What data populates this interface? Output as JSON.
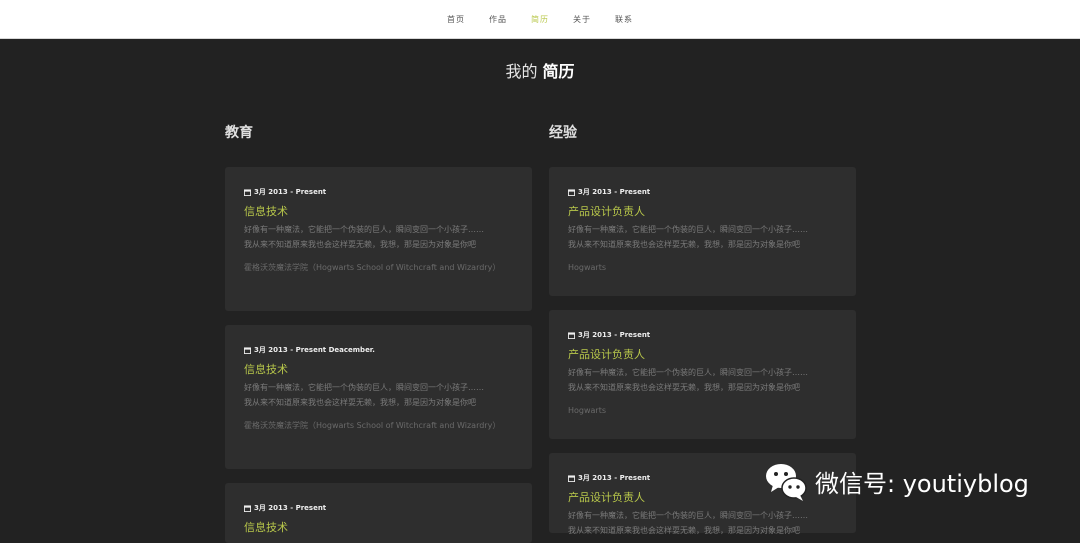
{
  "nav": {
    "items": [
      {
        "label": "首页",
        "active": false
      },
      {
        "label": "作品",
        "active": false
      },
      {
        "label": "简历",
        "active": true
      },
      {
        "label": "关于",
        "active": false
      },
      {
        "label": "联系",
        "active": false
      }
    ]
  },
  "page_title": {
    "prefix": "我的",
    "main": "简历"
  },
  "education": {
    "heading": "教育",
    "cards": [
      {
        "date": "3月 2013 - Present",
        "role": "信息技术",
        "desc1": "好像有一种魔法，它能把一个伪装的巨人，瞬间变回一个小孩子……",
        "desc2": "我从来不知道原来我也会这样耍无赖，我想，那是因为对象是你吧",
        "org": "霍格沃茨魔法学院（Hogwarts School of Witchcraft and Wizardry）"
      },
      {
        "date": "3月 2013 - Present Deacember.",
        "role": "信息技术",
        "desc1": "好像有一种魔法，它能把一个伪装的巨人，瞬间变回一个小孩子……",
        "desc2": "我从来不知道原来我也会这样耍无赖，我想，那是因为对象是你吧",
        "org": "霍格沃茨魔法学院（Hogwarts School of Witchcraft and Wizardry）"
      },
      {
        "date": "3月 2013 - Present",
        "role": "信息技术"
      }
    ]
  },
  "experience": {
    "heading": "经验",
    "cards": [
      {
        "date": "3月 2013 - Present",
        "role": "产品设计负责人",
        "desc1": "好像有一种魔法，它能把一个伪装的巨人，瞬间变回一个小孩子……",
        "desc2": "我从来不知道原来我也会这样耍无赖，我想，那是因为对象是你吧",
        "org": "Hogwarts"
      },
      {
        "date": "3月 2013 - Present",
        "role": "产品设计负责人",
        "desc1": "好像有一种魔法，它能把一个伪装的巨人，瞬间变回一个小孩子……",
        "desc2": "我从来不知道原来我也会这样耍无赖，我想，那是因为对象是你吧",
        "org": "Hogwarts"
      },
      {
        "date": "3月 2013 - Present",
        "role": "产品设计负责人",
        "desc1": "好像有一种魔法，它能把一个伪装的巨人，瞬间变回一个小孩子……",
        "desc2": "我从来不知道原来我也会这样耍无赖，我想，那是因为对象是你吧"
      }
    ]
  },
  "watermark": {
    "text": "微信号: youtiyblog",
    "icon": "wechat-icon"
  },
  "colors": {
    "accent": "#b8c74a",
    "background": "#222222",
    "card": "#2e2e2e"
  }
}
